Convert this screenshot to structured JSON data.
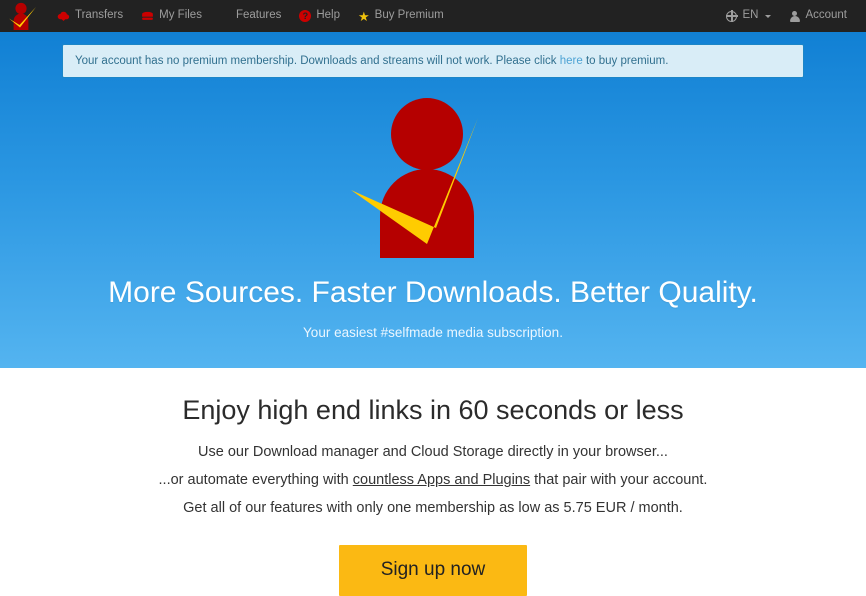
{
  "navbar": {
    "brand": {
      "icon": "brand-logo-icon",
      "alt": "Brand logo"
    },
    "left_items": [
      {
        "label": "Transfers",
        "icon": "cloud-download-icon"
      },
      {
        "label": "My Files",
        "icon": "files-stack-icon"
      },
      {
        "label": "Features",
        "icon": "grid-icon"
      },
      {
        "label": "Help",
        "icon": "question-circle-icon"
      },
      {
        "label": "Buy Premium",
        "icon": "star-icon"
      }
    ],
    "right_items": [
      {
        "label": "EN",
        "icon": "globe-icon",
        "caret": true
      },
      {
        "label": "Account",
        "icon": "user-icon",
        "caret": false
      }
    ]
  },
  "alert": {
    "text_before": "Your account has no premium membership. Downloads and streams will not work. Please click ",
    "link_text": "here",
    "text_after": " to buy premium."
  },
  "hero": {
    "logo_icon": "mascot-check-logo-icon",
    "title": "More Sources. Faster Downloads. Better Quality.",
    "subtitle": "Your easiest #selfmade media subscription."
  },
  "main": {
    "heading": "Enjoy high end links in 60 seconds or less",
    "line1": "Use our Download manager and Cloud Storage directly in your browser...",
    "line2_before": "...or automate everything with ",
    "line2_link": "countless Apps and Plugins",
    "line2_after": " that pair with your account.",
    "line3": "Get all of our features with only one membership as low as 5.75 EUR / month.",
    "cta_label": "Sign up now"
  },
  "colors": {
    "navbar_bg": "#222222",
    "brand_red": "#b50000",
    "brand_yellow": "#ffcc00",
    "cta_bg": "#fbb913",
    "hero_top": "#1180d4",
    "hero_bottom": "#54b4f0",
    "alert_bg": "#d9edf7",
    "alert_border": "#1d86c7"
  }
}
